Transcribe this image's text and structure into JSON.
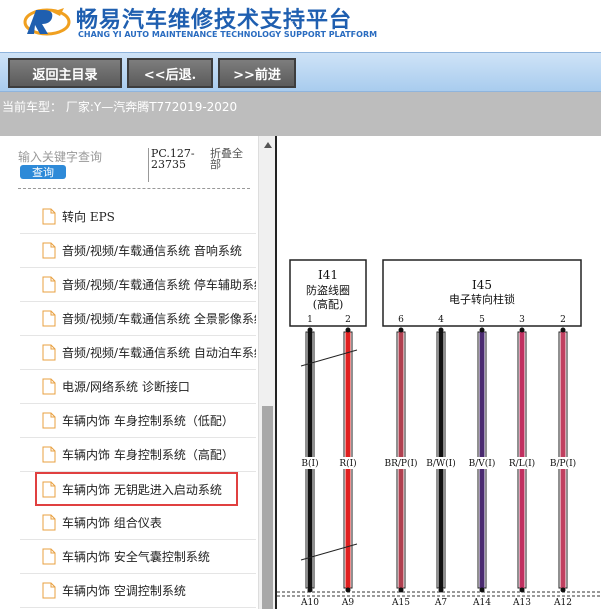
{
  "header": {
    "title": "畅易汽车维修技术支持平台",
    "subtitle": "CHANG YI AUTO MAINTENANCE TECHNOLOGY SUPPORT PLATFORM"
  },
  "toolbar": {
    "home_label": "返回主目录",
    "back_label": "<<后退.",
    "forward_label": ">>前进"
  },
  "vehicle": {
    "text": "当前车型： 厂家:Y—汽奔腾T772019-2020"
  },
  "search": {
    "placeholder": "输入关键字查询",
    "button": "查询",
    "code": "PC.127-23735",
    "collapse": "折叠全部"
  },
  "tree": {
    "items": [
      "转向 EPS",
      "音频/视频/车载通信系统 音响系统",
      "音频/视频/车载通信系统 停车辅助系统",
      "音频/视频/车载通信系统 全景影像系统",
      "音频/视频/车载通信系统 自动泊车系统",
      "电源/网络系统 诊断接口",
      "车辆内饰 车身控制系统（低配）",
      "车辆内饰 车身控制系统（高配）",
      "车辆内饰 无钥匙进入启动系统",
      "车辆内饰 组合仪表",
      "车辆内饰 安全气囊控制系统",
      "车辆内饰 空调控制系统"
    ],
    "selected_index": 8
  },
  "diagram": {
    "left_box": {
      "id": "I41",
      "name": "防盗线圈",
      "note": "(高配)"
    },
    "right_box": {
      "id": "I45",
      "name": "电子转向柱锁"
    },
    "wires": [
      {
        "pin": "1",
        "label": "B(I)",
        "terminal": "A10",
        "color": "#111111"
      },
      {
        "pin": "2",
        "label": "R(I)",
        "terminal": "A9",
        "color": "#e02020"
      },
      {
        "pin": "6",
        "label": "BR/P(I)",
        "terminal": "A15",
        "color": "#b04050"
      },
      {
        "pin": "4",
        "label": "B/W(I)",
        "terminal": "A7",
        "color": "#111111"
      },
      {
        "pin": "5",
        "label": "B/V(I)",
        "terminal": "A14",
        "color": "#4a2a70"
      },
      {
        "pin": "3",
        "label": "R/L(I)",
        "terminal": "A13",
        "color": "#c03060"
      },
      {
        "pin": "2",
        "label": "B/P(I)",
        "terminal": "A12",
        "color": "#c04060"
      }
    ]
  },
  "colors": {
    "brand": "#1f5fb0",
    "toolbar": "#a9ccee",
    "button": "#6a6a6a",
    "highlight": "#e04040",
    "search_button": "#2e8ad8"
  }
}
